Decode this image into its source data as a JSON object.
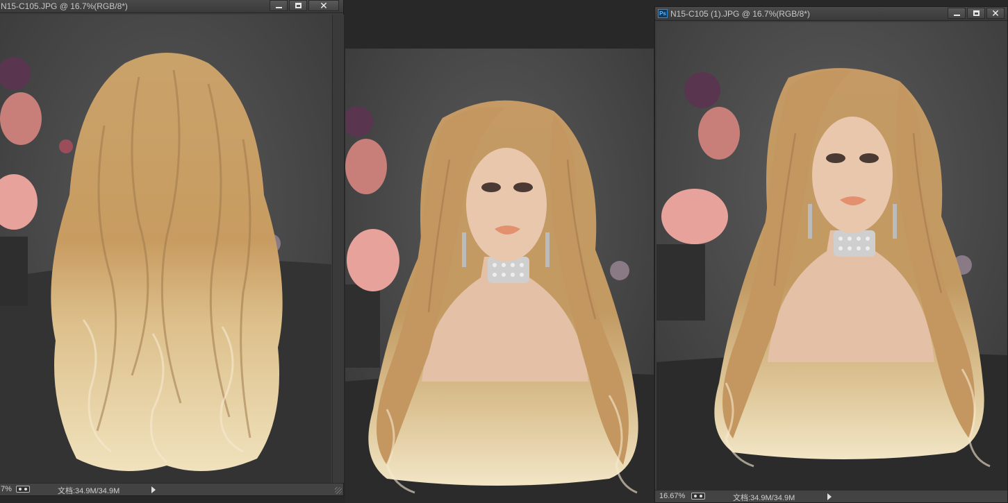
{
  "windows": [
    {
      "title": "N15-C105.JPG @ 16.7%(RGB/8*)",
      "zoom": "7%",
      "doc_size": "文档:34.9M/34.9M",
      "view": "back"
    },
    {
      "title": "",
      "view": "front"
    },
    {
      "title": "N15-C105 (1).JPG @ 16.7%(RGB/8*)",
      "app_icon": "Ps",
      "zoom": "16.67%",
      "doc_size": "文档:34.9M/34.9M",
      "view": "front"
    }
  ],
  "icons": {
    "minimize": "minimize-icon",
    "maximize": "maximize-icon",
    "close": "close-icon",
    "navigator": "navigator-icon",
    "status_menu": "triangle-right-icon",
    "app": "photoshop-icon",
    "resize": "resize-grip-icon"
  },
  "colors": {
    "workspace": "#282828",
    "hair_light": "#e6cf9e",
    "hair_mid": "#c29a62",
    "hair_dark": "#9c7447",
    "backdrop": "#4a4a4a",
    "skin": "#e3c0a6",
    "lips": "#e2906e"
  }
}
